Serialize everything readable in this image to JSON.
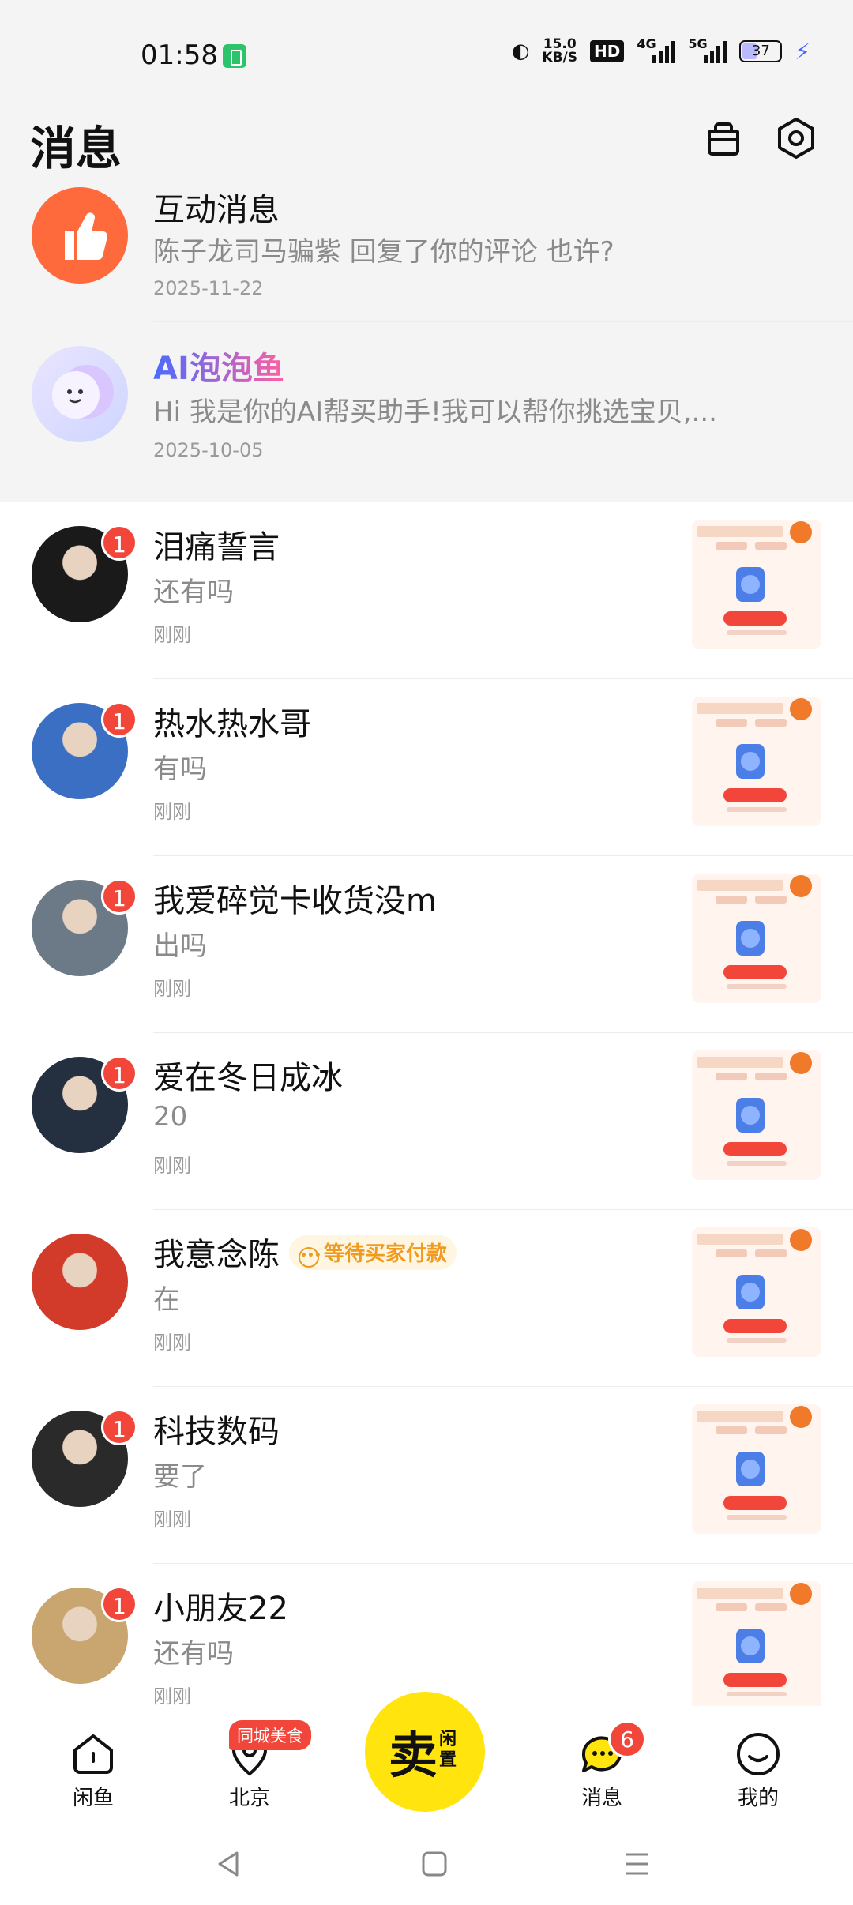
{
  "status_bar": {
    "time": "01:58",
    "net_speed_value": "15.0",
    "net_speed_unit": "KB/S",
    "hd_label": "HD",
    "signal1_gen": "4G",
    "signal2_gen": "5G",
    "battery": "37",
    "charging": true
  },
  "header": {
    "title": "消息",
    "icons": [
      "shopping-bag-icon",
      "settings-icon"
    ]
  },
  "pinned": [
    {
      "name": "互动消息",
      "message": "陈子龙司马骗紫 回复了你的评论 也许?",
      "time": "2025-11-22",
      "icon": "thumbs-up-icon",
      "color": "#ff6a3d"
    },
    {
      "name": "AI泡泡鱼",
      "message": "Hi 我是你的AI帮买助手!我可以帮你挑选宝贝,...",
      "time": "2025-10-05",
      "icon": "ai-bubble-fish-icon",
      "gradient": [
        "#4b6bff",
        "#ff5fa2"
      ]
    }
  ],
  "conversations": [
    {
      "name": "泪痛誓言",
      "message": "还有吗",
      "time": "刚刚",
      "unread": "1"
    },
    {
      "name": "热水热水哥",
      "message": " 有吗",
      "time": "刚刚",
      "unread": "1"
    },
    {
      "name": "我爱碎觉卡收货没m",
      "message": "出吗",
      "time": "刚刚",
      "unread": "1"
    },
    {
      "name": "爱在冬日成冰",
      "message": "20",
      "time": "刚刚",
      "unread": "1"
    },
    {
      "name": "我意念陈",
      "message": "在",
      "time": "刚刚",
      "unread": "",
      "tag": "等待买家付款"
    },
    {
      "name": "科技数码",
      "message": "要了",
      "time": "刚刚",
      "unread": "1"
    },
    {
      "name": "小朋友22",
      "message": "还有吗",
      "time": "刚刚",
      "unread": "1"
    }
  ],
  "tab_bar": {
    "items": [
      {
        "label": "闲鱼",
        "icon": "home-icon"
      },
      {
        "label": "北京",
        "icon": "location-icon",
        "tag": "同城美食"
      },
      {
        "label": "消息",
        "icon": "message-icon",
        "badge": "6"
      },
      {
        "label": "我的",
        "icon": "profile-icon"
      }
    ],
    "sell": {
      "main": "卖",
      "sub": "闲置"
    }
  },
  "colors": {
    "accent_yellow": "#ffe40e",
    "badge_red": "#f2463a",
    "pending_orange": "#f09a1e"
  }
}
